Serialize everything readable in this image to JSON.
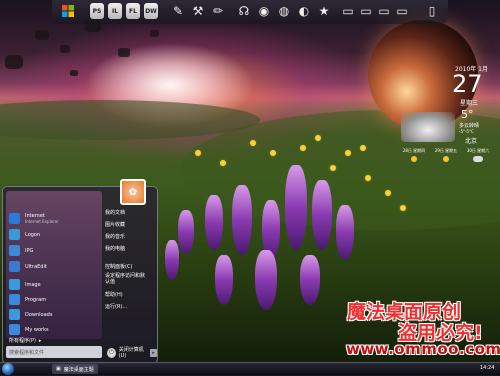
{
  "toolbar": {
    "items": [
      {
        "icon": "windows-logo-icon"
      },
      {
        "label": "PS"
      },
      {
        "label": "IL"
      },
      {
        "label": "FL"
      },
      {
        "label": "DW"
      },
      {
        "icon": "brush-icon"
      },
      {
        "icon": "wrench-icon"
      },
      {
        "icon": "pencil-icon"
      },
      {
        "icon": "headphones-icon"
      },
      {
        "icon": "chat-icon"
      },
      {
        "icon": "globe-icon"
      },
      {
        "icon": "media-icon"
      },
      {
        "icon": "star-icon"
      },
      {
        "icon": "folder-icon"
      },
      {
        "icon": "folder-icon"
      },
      {
        "icon": "folder-icon"
      },
      {
        "icon": "folder-icon"
      },
      {
        "icon": "trash-icon"
      }
    ]
  },
  "calendar": {
    "year_month": "2010年 1月",
    "day": "27",
    "weekday": "星期三"
  },
  "weather": {
    "temp": "5°",
    "condition": "多云转晴",
    "range": "-5°-5°C",
    "city": "北京",
    "forecast": [
      {
        "label": "28日 星期四"
      },
      {
        "label": "29日 星期五"
      },
      {
        "label": "30日 星期六"
      }
    ]
  },
  "start_menu": {
    "programs": [
      {
        "label": "Internet",
        "sub": "Internet Explorer",
        "icon": "ie-icon",
        "color": "#2a7ad8"
      },
      {
        "label": "Logon",
        "sub": "",
        "icon": "logon-icon",
        "color": "#3a9ad8"
      },
      {
        "label": "IPG",
        "sub": "",
        "icon": "ipg-icon",
        "color": "#3a8ad8"
      },
      {
        "label": "UltraEdit",
        "sub": "",
        "icon": "ultraedit-icon",
        "color": "#3a7ad0"
      },
      {
        "label": "Image",
        "sub": "",
        "icon": "image-icon",
        "color": "#3a9ae0"
      },
      {
        "label": "Program",
        "sub": "",
        "icon": "program-icon",
        "color": "#3a8ae0"
      },
      {
        "label": "Downloads",
        "sub": "",
        "icon": "downloads-icon",
        "color": "#3a9ae0"
      },
      {
        "label": "My works",
        "sub": "",
        "icon": "myworks-icon",
        "color": "#3a8ad8"
      }
    ],
    "right_links": [
      "我的文档",
      "图片收藏",
      "我的音乐",
      "我的电脑",
      "控制面板(C)",
      "设定程序访问和默认值",
      "帮助(H)",
      "运行(R)..."
    ],
    "all_programs": "所有程序(P)",
    "search_placeholder": "搜索程序和文件",
    "shutdown_label": "关闭计算机(U)"
  },
  "taskbar": {
    "item_label": "魔法桌面主题",
    "clock": "14:24"
  },
  "watermark": {
    "line1": "魔法桌面原创",
    "line2": "盗用必究!",
    "line3": "www.ommoo.com"
  }
}
